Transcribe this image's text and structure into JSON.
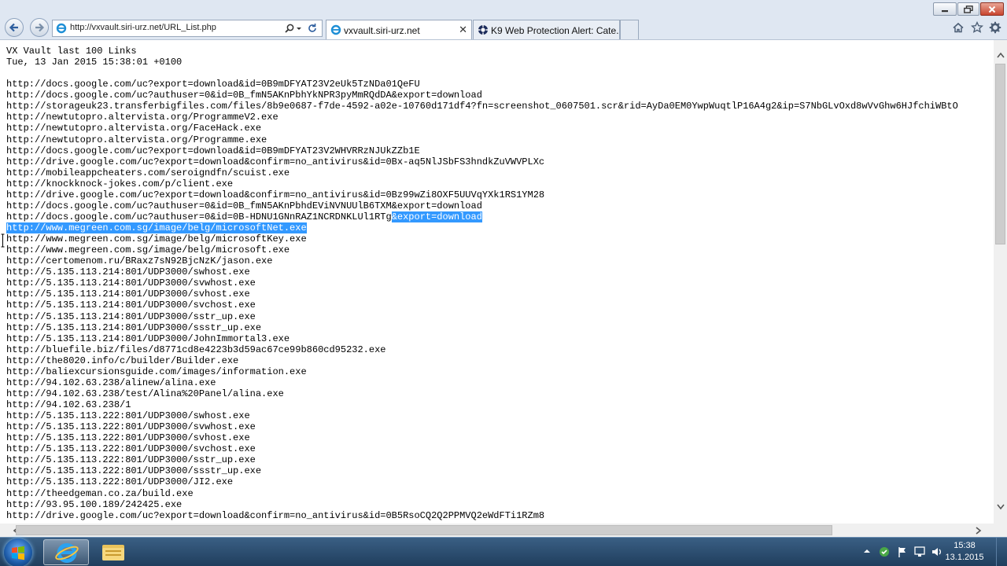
{
  "browser": {
    "address": "http://vxvault.siri-urz.net/URL_List.php",
    "tabs": [
      {
        "label": "vxvault.siri-urz.net",
        "active": true
      },
      {
        "label": "K9 Web Protection Alert: Cate...",
        "active": false
      }
    ],
    "icons": {
      "back": "back-arrow-icon",
      "forward": "forward-arrow-icon",
      "search": "search-icon",
      "refresh": "refresh-icon",
      "home": "home-icon",
      "favorites": "star-icon",
      "settings": "gear-icon"
    }
  },
  "page": {
    "title_line": "VX Vault last 100 Links",
    "date_line": "Tue, 13 Jan 2015 15:38:01 +0100",
    "lines_before_selection": [
      "http://docs.google.com/uc?export=download&id=0B9mDFYAT23V2eUk5TzNDa01QeFU",
      "http://docs.google.com/uc?authuser=0&id=0B_fmN5AKnPbhYkNPR3pyMmRQdDA&export=download",
      "http://storageuk23.transferbigfiles.com/files/8b9e0687-f7de-4592-a02e-10760d171df4?fn=screenshot_0607501.scr&rid=AyDa0EM0YwpWuqtlP16A4g2&ip=S7NbGLvOxd8wVvGhw6HJfchiWBtO",
      "http://newtutopro.altervista.org/ProgrammeV2.exe",
      "http://newtutopro.altervista.org/FaceHack.exe",
      "http://newtutopro.altervista.org/Programme.exe",
      "http://docs.google.com/uc?export=download&id=0B9mDFYAT23V2WHVRRzNJUkZZb1E",
      "http://drive.google.com/uc?export=download&confirm=no_antivirus&id=0Bx-aq5NlJSbFS3hndkZuVWVPLXc",
      "http://mobileappcheaters.com/seroigndfn/scuist.exe",
      "http://knockknock-jokes.com/p/client.exe",
      "http://drive.google.com/uc?export=download&confirm=no_antivirus&id=0Bz99wZi8OXF5UUVqYXk1RS1YM28",
      "http://docs.google.com/uc?authuser=0&id=0B_fmN5AKnPbhdEViNVNUUlB6TXM&export=download"
    ],
    "partial_line_start": "http://docs.google.com/uc?authuser=0&id=0B-HDNU1GNnRAZ1NCRDNKLUl1RTg",
    "partial_line_selected": "&export=download",
    "selected_line": "http://www.megreen.com.sg/image/belg/microsoftNet.exe",
    "lines_after_selection": [
      "http://www.megreen.com.sg/image/belg/microsoftKey.exe",
      "http://www.megreen.com.sg/image/belg/microsoft.exe",
      "http://certomenom.ru/BRaxz7sN92BjcNzK/jason.exe",
      "http://5.135.113.214:801/UDP3000/swhost.exe",
      "http://5.135.113.214:801/UDP3000/svwhost.exe",
      "http://5.135.113.214:801/UDP3000/svhost.exe",
      "http://5.135.113.214:801/UDP3000/svchost.exe",
      "http://5.135.113.214:801/UDP3000/sstr_up.exe",
      "http://5.135.113.214:801/UDP3000/ssstr_up.exe",
      "http://5.135.113.214:801/UDP3000/JohnImmortal3.exe",
      "http://bluefile.biz/files/d8771cd8e4223b3d59ac67ce99b860cd95232.exe",
      "http://the8020.info/c/builder/Builder.exe",
      "http://baliexcursionsguide.com/images/information.exe",
      "http://94.102.63.238/alinew/alina.exe",
      "http://94.102.63.238/test/Alina%20Panel/alina.exe",
      "http://94.102.63.238/1",
      "http://5.135.113.222:801/UDP3000/swhost.exe",
      "http://5.135.113.222:801/UDP3000/svwhost.exe",
      "http://5.135.113.222:801/UDP3000/svhost.exe",
      "http://5.135.113.222:801/UDP3000/svchost.exe",
      "http://5.135.113.222:801/UDP3000/sstr_up.exe",
      "http://5.135.113.222:801/UDP3000/ssstr_up.exe",
      "http://5.135.113.222:801/UDP3000/JI2.exe",
      "http://theedgeman.co.za/build.exe",
      "http://93.95.100.189/242425.exe",
      "http://drive.google.com/uc?export=download&confirm=no_antivirus&id=0B5RsoCQ2Q2PPMVQ2eWdFTi1RZm8"
    ]
  },
  "taskbar": {
    "time": "15:38",
    "date": "13.1.2015",
    "apps": [
      "internet-explorer",
      "file-explorer"
    ]
  },
  "colors": {
    "selection": "#3399ff",
    "chrome": "#dfe7f2",
    "taskbar": "#2b4c6f"
  }
}
